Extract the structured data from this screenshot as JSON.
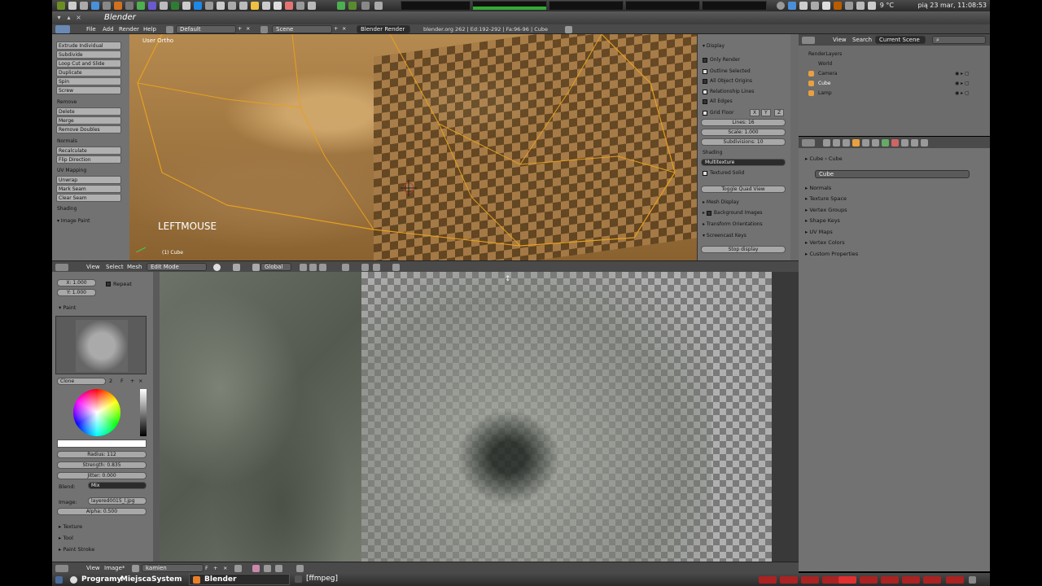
{
  "system_top": {
    "clock": "pią 23 mar, 11:08:53",
    "temperature": "9 °C"
  },
  "window": {
    "title": "Blender"
  },
  "header": {
    "menus": [
      "File",
      "Add",
      "Render",
      "Help"
    ],
    "layout": "Default",
    "scene": "Scene",
    "engine": "Blender Render",
    "stats": "blender.org 262 | Ed:192-292 | Fa:96-96 | Cube"
  },
  "toolshelf": {
    "buttons": [
      "Extrude Individual",
      "Subdivide",
      "Loop Cut and Slide",
      "Duplicate",
      "Spin",
      "Screw"
    ],
    "remove_label": "Remove",
    "remove_buttons": [
      "Delete",
      "Merge",
      "Remove Doubles"
    ],
    "normals_label": "Normals",
    "normals_buttons": [
      "Recalculate",
      "Flip Direction"
    ],
    "uv_label": "UV Mapping",
    "uv_buttons": [
      "Unwrap",
      "Mark Seam",
      "Clear Seam"
    ],
    "shading_label": "Shading",
    "image_paint": "Image Paint"
  },
  "viewport": {
    "view_label": "User Ortho",
    "key_overlay": "LEFTMOUSE",
    "object_label": "(1) Cube"
  },
  "npanel": {
    "display": "Display",
    "checks": [
      "Only Render",
      "Outline Selected",
      "All Object Origins",
      "Relationship Lines",
      "All Edges"
    ],
    "grid_floor": "Grid Floor",
    "axes": [
      "X",
      "Y",
      "Z"
    ],
    "lines": "Lines: 16",
    "scale": "Scale: 1.000",
    "subdivisions": "Subdivisions: 10",
    "shading": "Shading",
    "shading_mode": "Multitexture",
    "textured_solid": "Textured Solid",
    "toggle_quad": "Toggle Quad View",
    "mesh_display": "Mesh Display",
    "background_images": "Background Images",
    "transform_orientations": "Transform Orientations",
    "screencast_keys": "Screencast Keys",
    "stop_display": "Stop display"
  },
  "outliner": {
    "menus": [
      "View",
      "Search"
    ],
    "scene_select": "Current Scene",
    "items": [
      "RenderLayers",
      "World",
      "Camera",
      "Cube",
      "Lamp"
    ]
  },
  "properties": {
    "breadcrumb": [
      "Cube",
      "Cube"
    ],
    "name": "Cube",
    "panels": [
      "Normals",
      "Texture Space",
      "Vertex Groups",
      "Shape Keys",
      "UV Maps",
      "Vertex Colors",
      "Custom Properties"
    ]
  },
  "midheader": {
    "menus": [
      "View",
      "Select",
      "Mesh"
    ],
    "mode": "Edit Mode",
    "orientation": "Global"
  },
  "paintpanel": {
    "x": "X: 1.000",
    "y": "Y: 1.000",
    "repeat": "Repeat",
    "paint": "Paint",
    "brush_name": "Clone",
    "brush_users": "2",
    "brush_f": "F",
    "radius": "Radius: 112",
    "strength": "Strength: 0.835",
    "jitter": "Jitter: 0.000",
    "blend_label": "Blend:",
    "blend": "Mix",
    "image_label": "Image:",
    "image": "layered0015_l.jpg",
    "alpha": "Alpha: 0.500",
    "texture": "Texture",
    "tool": "Tool",
    "paint_stroke": "Paint Stroke"
  },
  "imghead": {
    "menus": [
      "View",
      "Image*"
    ],
    "image_name": "kamien",
    "f": "F"
  },
  "taskbar": {
    "items": [
      "Programy",
      "Miejsca",
      "System"
    ],
    "blender": "Blender",
    "ffmpeg": "[ffmpeg]"
  }
}
